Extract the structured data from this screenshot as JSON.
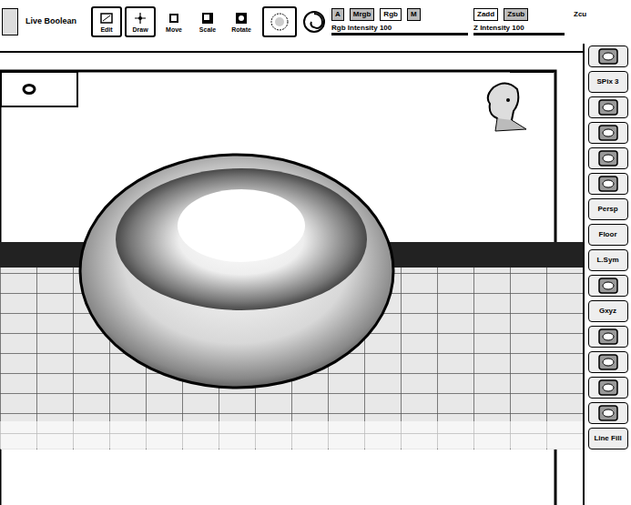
{
  "toolbar": {
    "live_boolean": {
      "label": "Live Boolean",
      "on": false
    },
    "tools": [
      {
        "label": "Edit",
        "selected": true
      },
      {
        "label": "Draw",
        "selected": true
      },
      {
        "label": "Move",
        "selected": false
      },
      {
        "label": "Scale",
        "selected": false
      },
      {
        "label": "Rotate",
        "selected": false
      }
    ],
    "color_modes": [
      {
        "label": "A",
        "selected": false
      },
      {
        "label": "Mrgb",
        "selected": false
      },
      {
        "label": "Rgb",
        "selected": true
      },
      {
        "label": "M",
        "selected": false
      }
    ],
    "z_modes": [
      {
        "label": "Zadd",
        "selected": true
      },
      {
        "label": "Zsub",
        "selected": false
      }
    ],
    "z_cut": "Zcu",
    "sliders": [
      {
        "label": "Rgb Intensity 100",
        "level": 1
      },
      {
        "label": "Z Intensity 100",
        "level": 1
      }
    ]
  },
  "sidebar": [
    {
      "kind": "icon",
      "label": ""
    },
    {
      "kind": "text",
      "label": "SPix 3"
    },
    {
      "kind": "icon",
      "label": ""
    },
    {
      "kind": "icon",
      "label": ""
    },
    {
      "kind": "icon",
      "label": ""
    },
    {
      "kind": "icon",
      "label": ""
    },
    {
      "kind": "text",
      "label": "Persp"
    },
    {
      "kind": "text",
      "label": "Floor"
    },
    {
      "kind": "text",
      "label": "L.Sym"
    },
    {
      "kind": "icon",
      "label": ""
    },
    {
      "kind": "text",
      "label": "Gxyz"
    },
    {
      "kind": "icon",
      "label": ""
    },
    {
      "kind": "icon",
      "label": ""
    },
    {
      "kind": "icon",
      "label": ""
    },
    {
      "kind": "icon",
      "label": ""
    },
    {
      "kind": "text",
      "label": "Line Fill"
    }
  ]
}
